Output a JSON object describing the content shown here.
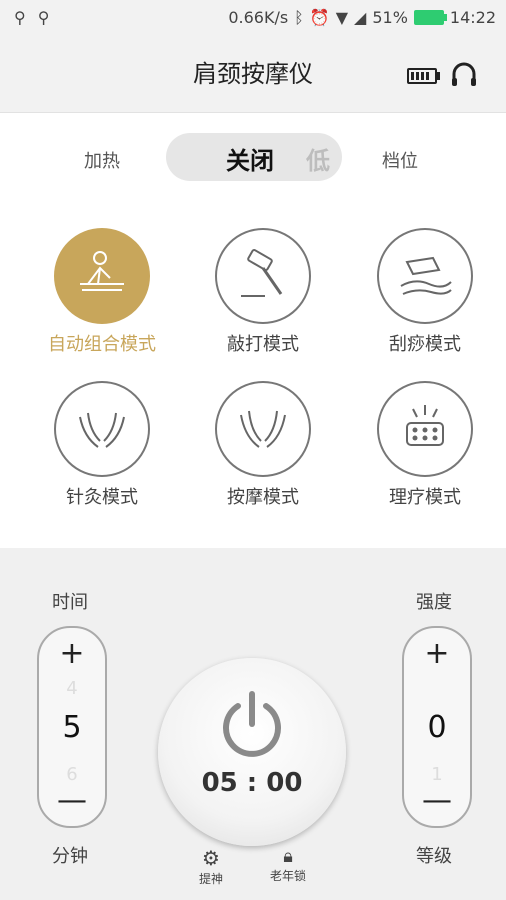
{
  "status_bar": {
    "left_icons": [
      "usb-icon",
      "usb-icon"
    ],
    "net_speed": "0.66K/s",
    "battery_percent": "51%",
    "time": "14:22"
  },
  "app_bar": {
    "title": "肩颈按摩仪",
    "device_battery_icon": "battery-icon",
    "headset_icon": "headset-icon"
  },
  "controls": {
    "heat_label": "加热",
    "toggle_state": "关闭",
    "toggle_next": "低",
    "gear_label": "档位"
  },
  "modes": [
    {
      "label": "自动组合模式",
      "icon": "massage-person-icon",
      "active": true
    },
    {
      "label": "敲打模式",
      "icon": "hammer-icon",
      "active": false
    },
    {
      "label": "刮痧模式",
      "icon": "scraping-icon",
      "active": false
    },
    {
      "label": "针灸模式",
      "icon": "acupuncture-hands-icon",
      "active": false
    },
    {
      "label": "按摩模式",
      "icon": "massage-hands-icon",
      "active": false
    },
    {
      "label": "理疗模式",
      "icon": "therapy-pad-icon",
      "active": false
    }
  ],
  "time_control": {
    "label": "时间",
    "plus": "+",
    "prev_value": "4",
    "value": "5",
    "next_value": "6",
    "minus": "—",
    "unit": "分钟"
  },
  "strength_control": {
    "label": "强度",
    "plus": "+",
    "value": "0",
    "next_value": "1",
    "minus": "—",
    "unit": "等级"
  },
  "power": {
    "timer": "05 : 00"
  },
  "bottom_actions": {
    "refresh": "提神",
    "elder_lock": "老年锁"
  },
  "colors": {
    "accent": "#c8a65b"
  }
}
